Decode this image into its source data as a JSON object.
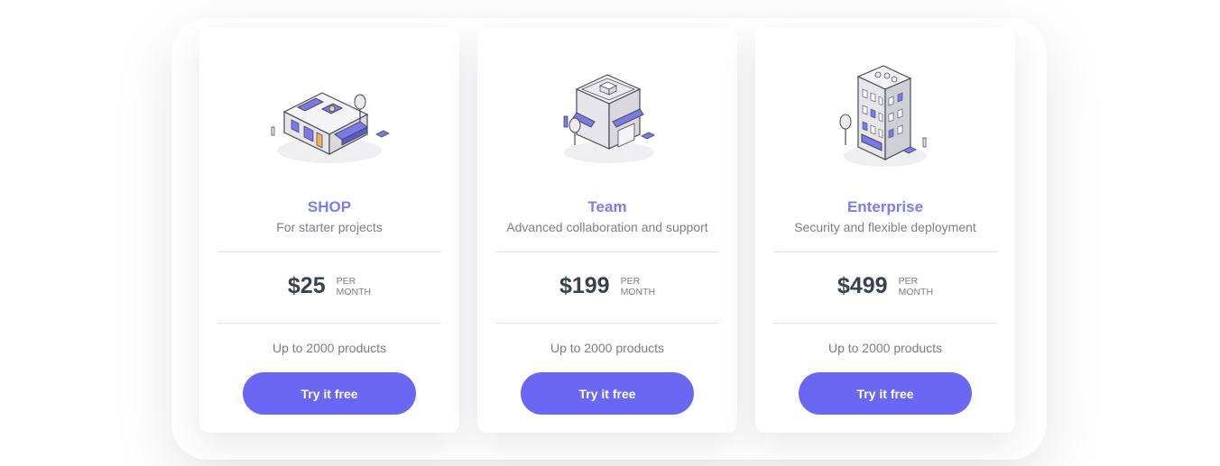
{
  "plans": [
    {
      "name": "SHOP",
      "description": "For starter projects",
      "price": "$25",
      "per_line1": "PER",
      "per_line2": "MONTH",
      "feature": "Up to 2000 products",
      "cta_label": "Try it free",
      "illustration": "shop-building-icon"
    },
    {
      "name": "Team",
      "description": "Advanced collaboration and support",
      "price": "$199",
      "per_line1": "PER",
      "per_line2": "MONTH",
      "feature": "Up to 2000 products",
      "cta_label": "Try it free",
      "illustration": "office-building-icon"
    },
    {
      "name": "Enterprise",
      "description": "Security and flexible deployment",
      "price": "$499",
      "per_line1": "PER",
      "per_line2": "MONTH",
      "feature": "Up to 2000 products",
      "cta_label": "Try it free",
      "illustration": "tower-building-icon"
    }
  ],
  "colors": {
    "accent": "#6a67f4",
    "plan_name": "#7c7cf3",
    "price": "#3a4250",
    "muted_text": "#7a7f87",
    "illustration_accent": "#7b78e8"
  }
}
